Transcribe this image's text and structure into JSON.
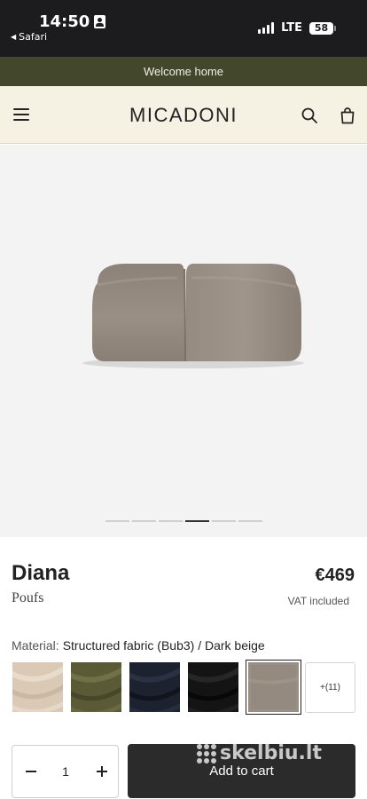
{
  "status_bar": {
    "time": "14:50",
    "back_app": "Safari",
    "network": "LTE",
    "battery": "58"
  },
  "announcement": {
    "text": "Welcome home"
  },
  "header": {
    "logo": "MICADONI",
    "icons": [
      "menu-icon",
      "search-icon",
      "bag-icon"
    ]
  },
  "gallery": {
    "image": "beige-pouf-photo",
    "total_images": 6,
    "current_index": 4
  },
  "product": {
    "name": "Diana",
    "category": "Poufs",
    "price": "€469",
    "vat_note": "VAT included",
    "material_label": "Material:",
    "material_value": "Structured fabric (Bub3) / Dark beige"
  },
  "swatches": {
    "items": [
      {
        "name": "light-beige",
        "color": "#d9c9b5"
      },
      {
        "name": "olive-green",
        "color": "#5a5a36"
      },
      {
        "name": "navy-blue",
        "color": "#1c2230"
      },
      {
        "name": "black",
        "color": "#141414"
      },
      {
        "name": "dark-beige",
        "color": "#9a8f84",
        "selected": true
      }
    ],
    "more_label": "+(11)"
  },
  "cart": {
    "quantity": "1",
    "add_label": "Add to cart"
  },
  "watermark": {
    "text": "skelbiu.lt"
  },
  "colors": {
    "status_bar": "#1c1c1e",
    "announcement_bg": "#43472c",
    "header_bg": "#f6f2e3",
    "gallery_bg": "#f3f3f3",
    "button_bg": "#2b2b2b"
  }
}
